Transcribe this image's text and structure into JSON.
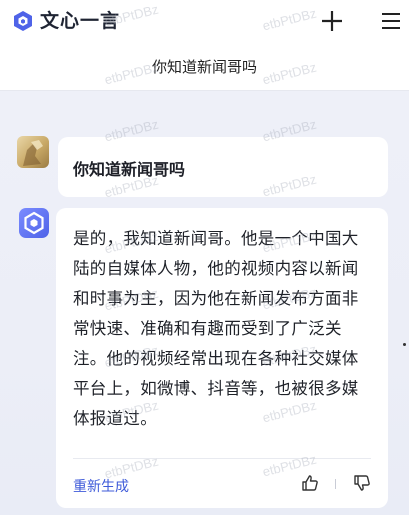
{
  "header": {
    "brand": "文心一言",
    "new_chat_icon": "plus-icon",
    "menu_icon": "menu-icon"
  },
  "conversation": {
    "title": "你知道新闻哥吗"
  },
  "messages": {
    "user": {
      "text": "你知道新闻哥吗"
    },
    "bot": {
      "text": "是的，我知道新闻哥。他是一个中国大陆的自媒体人物，他的视频内容以新闻和时事为主，因为他在新闻发布方面非常快速、准确和有趣而受到了广泛关注。他的视频经常出现在各种社交媒体平台上，如微博、抖音等，也被很多媒体报道过。",
      "regenerate_label": "重新生成",
      "like_icon": "thumbs-up-icon",
      "dislike_icon": "thumbs-down-icon"
    }
  },
  "watermark": "etbPtDBz",
  "colors": {
    "accent": "#3f5bd9",
    "logo": "#4f63e8",
    "chat_background": "#eceef7"
  }
}
